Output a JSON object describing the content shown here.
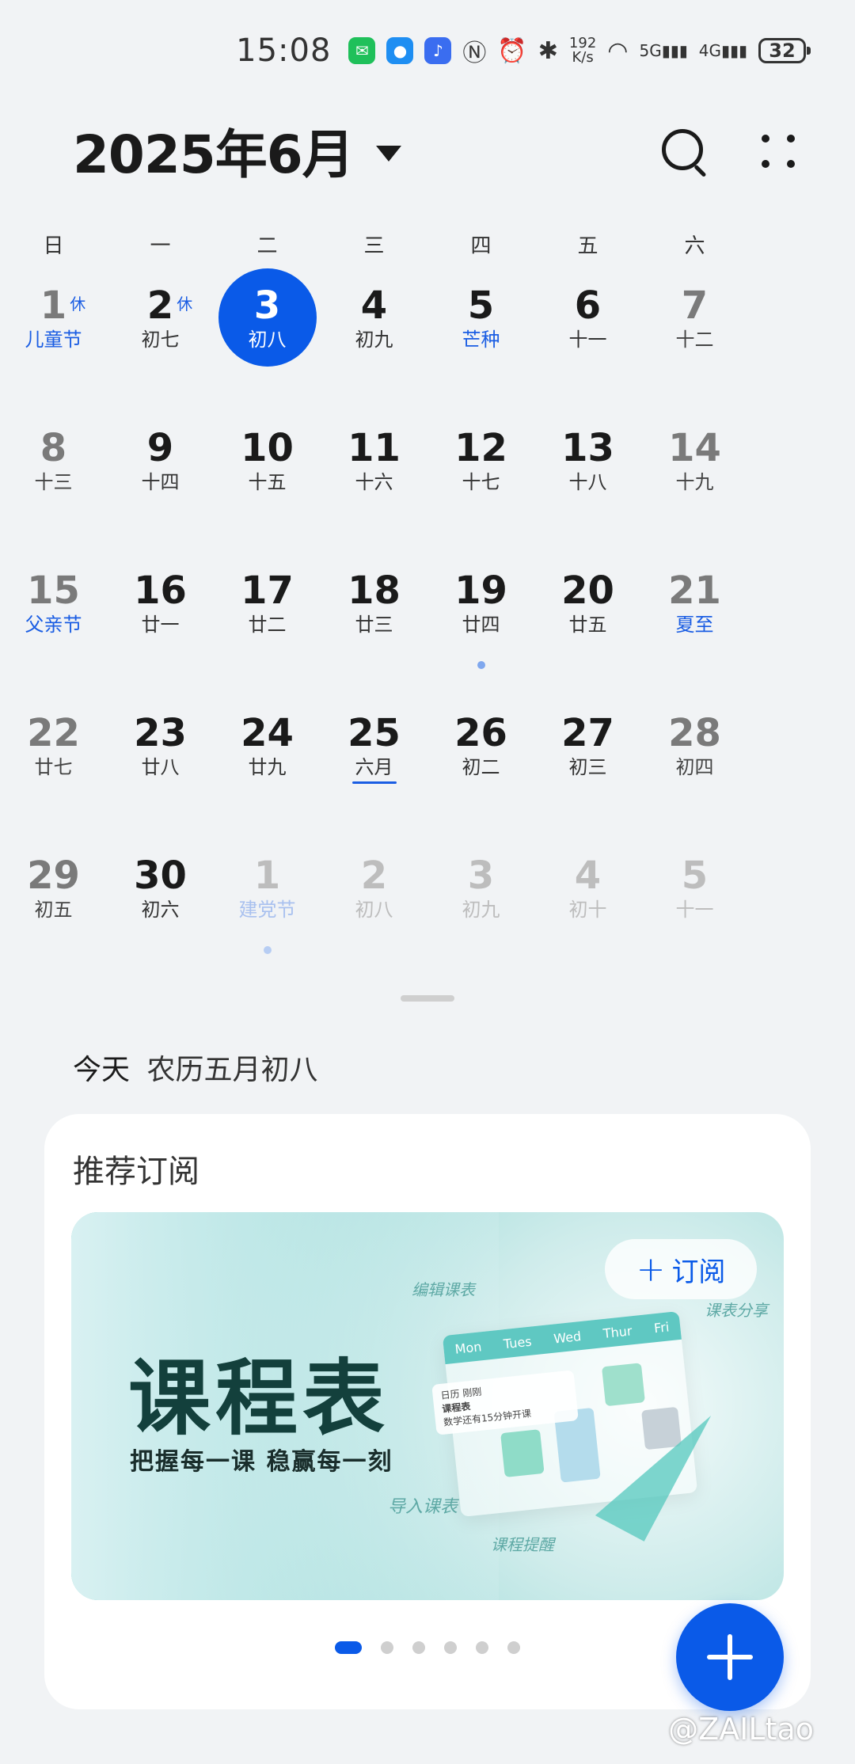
{
  "status_bar": {
    "time": "15:08",
    "net_speed_value": "192",
    "net_speed_unit": "K/s",
    "signal_5g": "5G",
    "signal_4g": "4G",
    "battery": "32"
  },
  "header": {
    "title": "2025年6月"
  },
  "weekdays": [
    "日",
    "一",
    "二",
    "三",
    "四",
    "五",
    "六"
  ],
  "calendar": {
    "rows": [
      [
        {
          "num": "1",
          "sub": "儿童节",
          "holiday": "休",
          "weekend": true,
          "festival": true
        },
        {
          "num": "2",
          "sub": "初七",
          "holiday": "休"
        },
        {
          "num": "3",
          "sub": "初八",
          "today": true
        },
        {
          "num": "4",
          "sub": "初九"
        },
        {
          "num": "5",
          "sub": "芒种",
          "festival": true
        },
        {
          "num": "6",
          "sub": "十一"
        },
        {
          "num": "7",
          "sub": "十二",
          "weekend": true
        }
      ],
      [
        {
          "num": "8",
          "sub": "十三",
          "weekend": true
        },
        {
          "num": "9",
          "sub": "十四"
        },
        {
          "num": "10",
          "sub": "十五"
        },
        {
          "num": "11",
          "sub": "十六"
        },
        {
          "num": "12",
          "sub": "十七"
        },
        {
          "num": "13",
          "sub": "十八"
        },
        {
          "num": "14",
          "sub": "十九",
          "weekend": true
        }
      ],
      [
        {
          "num": "15",
          "sub": "父亲节",
          "weekend": true,
          "festival": true
        },
        {
          "num": "16",
          "sub": "廿一"
        },
        {
          "num": "17",
          "sub": "廿二"
        },
        {
          "num": "18",
          "sub": "廿三"
        },
        {
          "num": "19",
          "sub": "廿四",
          "dot": true
        },
        {
          "num": "20",
          "sub": "廿五"
        },
        {
          "num": "21",
          "sub": "夏至",
          "weekend": true,
          "festival": true
        }
      ],
      [
        {
          "num": "22",
          "sub": "廿七",
          "weekend": true
        },
        {
          "num": "23",
          "sub": "廿八"
        },
        {
          "num": "24",
          "sub": "廿九"
        },
        {
          "num": "25",
          "sub": "六月",
          "underline": true
        },
        {
          "num": "26",
          "sub": "初二"
        },
        {
          "num": "27",
          "sub": "初三"
        },
        {
          "num": "28",
          "sub": "初四",
          "weekend": true
        }
      ],
      [
        {
          "num": "29",
          "sub": "初五",
          "weekend": true
        },
        {
          "num": "30",
          "sub": "初六"
        },
        {
          "num": "1",
          "sub": "建党节",
          "other": true,
          "festival": true,
          "dot": true
        },
        {
          "num": "2",
          "sub": "初八",
          "other": true
        },
        {
          "num": "3",
          "sub": "初九",
          "other": true
        },
        {
          "num": "4",
          "sub": "初十",
          "other": true
        },
        {
          "num": "5",
          "sub": "十一",
          "other": true
        }
      ]
    ]
  },
  "today": {
    "label": "今天",
    "lunar": "农历五月初八"
  },
  "recommend": {
    "title": "推荐订阅",
    "banner": {
      "title": "课程表",
      "slogan": "把握每一课 稳赢每一刻",
      "subscribe_label": "订阅",
      "deco_1": "编辑课表",
      "deco_2": "课表分享",
      "deco_3": "导入课表",
      "deco_4": "课程提醒",
      "mock_days": [
        "Mon",
        "Tues",
        "Wed",
        "Thur",
        "Fri"
      ],
      "mock_note_line1": "日历 刚刚",
      "mock_note_line2": "课程表",
      "mock_note_line3": "数学还有15分钟开课"
    },
    "pager_count": 6,
    "pager_active": 0
  },
  "watermark": "@ZAILtao",
  "colors": {
    "accent": "#0a5ae8",
    "festival": "#1a5de3",
    "background": "#f1f3f5"
  }
}
